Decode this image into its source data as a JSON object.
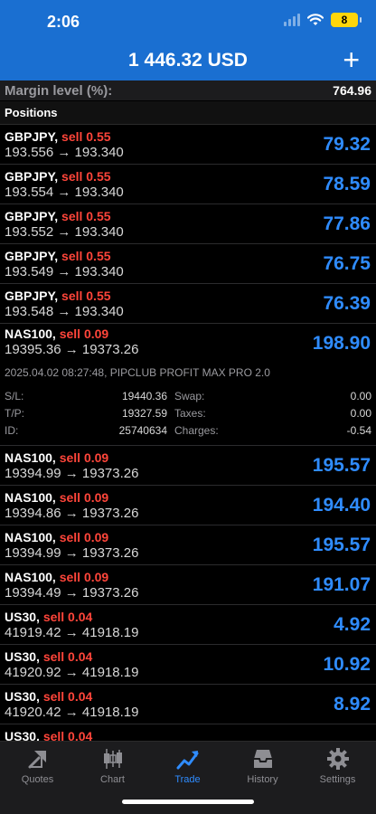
{
  "status": {
    "time": "2:06",
    "battery": "8"
  },
  "header": {
    "balance": "1 446.32 USD",
    "add_label": "+"
  },
  "margin": {
    "label": "Margin level (%):",
    "value": "764.96"
  },
  "positions_title": "Positions",
  "positions_a": [
    {
      "symbol": "GBPJPY,",
      "side": "sell 0.55",
      "prices": "193.556 → 193.340",
      "profit": "79.32"
    },
    {
      "symbol": "GBPJPY,",
      "side": "sell 0.55",
      "prices": "193.554 → 193.340",
      "profit": "78.59"
    },
    {
      "symbol": "GBPJPY,",
      "side": "sell 0.55",
      "prices": "193.552 → 193.340",
      "profit": "77.86"
    },
    {
      "symbol": "GBPJPY,",
      "side": "sell 0.55",
      "prices": "193.549 → 193.340",
      "profit": "76.75"
    },
    {
      "symbol": "GBPJPY,",
      "side": "sell 0.55",
      "prices": "193.548 → 193.340",
      "profit": "76.39"
    }
  ],
  "expanded": {
    "symbol": "NAS100,",
    "side": "sell 0.09",
    "prices": "19395.36 → 19373.26",
    "profit": "198.90",
    "comment": "2025.04.02 08:27:48, PIPCLUB PROFIT MAX PRO 2.0",
    "sl_label": "S/L:",
    "sl_value": "19440.36",
    "tp_label": "T/P:",
    "tp_value": "19327.59",
    "id_label": "ID:",
    "id_value": "25740634",
    "swap_label": "Swap:",
    "swap_value": "0.00",
    "taxes_label": "Taxes:",
    "taxes_value": "0.00",
    "charges_label": "Charges:",
    "charges_value": "-0.54"
  },
  "positions_b": [
    {
      "symbol": "NAS100,",
      "side": "sell 0.09",
      "prices": "19394.99 → 19373.26",
      "profit": "195.57"
    },
    {
      "symbol": "NAS100,",
      "side": "sell 0.09",
      "prices": "19394.86 → 19373.26",
      "profit": "194.40"
    },
    {
      "symbol": "NAS100,",
      "side": "sell 0.09",
      "prices": "19394.99 → 19373.26",
      "profit": "195.57"
    },
    {
      "symbol": "NAS100,",
      "side": "sell 0.09",
      "prices": "19394.49 → 19373.26",
      "profit": "191.07"
    },
    {
      "symbol": "US30,",
      "side": "sell 0.04",
      "prices": "41919.42 → 41918.19",
      "profit": "4.92"
    },
    {
      "symbol": "US30,",
      "side": "sell 0.04",
      "prices": "41920.92 → 41918.19",
      "profit": "10.92"
    },
    {
      "symbol": "US30,",
      "side": "sell 0.04",
      "prices": "41920.42 → 41918.19",
      "profit": "8.92"
    },
    {
      "symbol": "US30,",
      "side": "sell 0.04",
      "prices": "",
      "profit": ""
    }
  ],
  "tabs": [
    {
      "label": "Quotes",
      "icon": "quotes-icon"
    },
    {
      "label": "Chart",
      "icon": "chart-icon"
    },
    {
      "label": "Trade",
      "icon": "trade-icon",
      "active": true
    },
    {
      "label": "History",
      "icon": "history-icon"
    },
    {
      "label": "Settings",
      "icon": "settings-icon"
    }
  ],
  "colors": {
    "accent": "#2f8cff",
    "header_bg": "#1a6fd1",
    "sell": "#ff453a"
  }
}
